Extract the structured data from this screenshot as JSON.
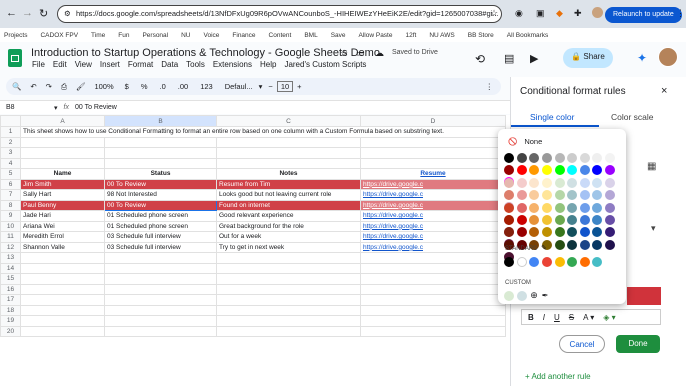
{
  "browser": {
    "url": "https://docs.google.com/spreadsheets/d/13NfDFxUg09R6pOVwANCounboS_-HIHEIWEzYHeEiK2E/edit?gid=1265007038#gi...",
    "relaunch": "Relaunch to update",
    "bookmarks": [
      "Projects",
      "CADOX FPV",
      "Time",
      "Fun",
      "Personal",
      "NU",
      "Voice",
      "Finance",
      "Content",
      "BML",
      "Save",
      "Allow Paste",
      "12ft",
      "NU AWS",
      "BB Store",
      "All Bookmarks"
    ]
  },
  "doc": {
    "title": "Introduction to Startup Operations & Technology - Google Sheets Demo",
    "saved": "Saved to Drive",
    "menus": [
      "File",
      "Edit",
      "View",
      "Insert",
      "Format",
      "Data",
      "Tools",
      "Extensions",
      "Help",
      "Jared's Custom Scripts"
    ],
    "share": "Share"
  },
  "toolbar": {
    "zoom": "100%",
    "currency": "$",
    "percent": "%",
    "dec1": ".0",
    "dec2": ".00",
    "num": "123",
    "font": "Defaul...",
    "size": "10"
  },
  "formula": {
    "cell": "B8",
    "value": "00 To Review"
  },
  "columns": [
    "A",
    "B",
    "C",
    "D"
  ],
  "rows": [
    {
      "n": "1",
      "a": "This sheet shows how to use Conditional Formatting to format an entire row based on one column with a Custom Formula based on substring text.",
      "b": "",
      "c": "",
      "d": "",
      "style": "note"
    },
    {
      "n": "2",
      "a": "",
      "b": "",
      "c": "",
      "d": ""
    },
    {
      "n": "3",
      "a": "",
      "b": "",
      "c": "",
      "d": ""
    },
    {
      "n": "4",
      "a": "",
      "b": "",
      "c": "",
      "d": ""
    },
    {
      "n": "5",
      "a": "Name",
      "b": "Status",
      "c": "Notes",
      "d": "Resume",
      "style": "header"
    },
    {
      "n": "6",
      "a": "Jim Smith",
      "b": "00 To Review",
      "c": "Resume from Tim",
      "d": "https://drive.google.c",
      "style": "red"
    },
    {
      "n": "7",
      "a": "Sally Hart",
      "b": "98 Not Interested",
      "c": "Looks good but not leaving current role",
      "d": "https://drive.google.c"
    },
    {
      "n": "8",
      "a": "Paul Benny",
      "b": "00 To Review",
      "c": "Found on internet",
      "d": "https://drive.google.c",
      "style": "red"
    },
    {
      "n": "9",
      "a": "Jade Hari",
      "b": "01 Scheduled phone screen",
      "c": "Good relevant experience",
      "d": "https://drive.google.c"
    },
    {
      "n": "10",
      "a": "Ariana Wei",
      "b": "01 Scheduled phone screen",
      "c": "Great background for the role",
      "d": "https://drive.google.c"
    },
    {
      "n": "11",
      "a": "Meredith Errol",
      "b": "03 Schedule full interview",
      "c": "Out for a week",
      "d": "https://drive.google.c"
    },
    {
      "n": "12",
      "a": "Shannon Valle",
      "b": "03 Schedule full interview",
      "c": "Try to get in next week",
      "d": "https://drive.google.c"
    },
    {
      "n": "13",
      "a": "",
      "b": "",
      "c": "",
      "d": ""
    },
    {
      "n": "14",
      "a": "",
      "b": "",
      "c": "",
      "d": ""
    },
    {
      "n": "15",
      "a": "",
      "b": "",
      "c": "",
      "d": ""
    },
    {
      "n": "16",
      "a": "",
      "b": "",
      "c": "",
      "d": ""
    },
    {
      "n": "17",
      "a": "",
      "b": "",
      "c": "",
      "d": ""
    },
    {
      "n": "18",
      "a": "",
      "b": "",
      "c": "",
      "d": ""
    },
    {
      "n": "19",
      "a": "",
      "b": "",
      "c": "",
      "d": ""
    },
    {
      "n": "20",
      "a": "",
      "b": "",
      "c": "",
      "d": ""
    }
  ],
  "panel": {
    "title": "Conditional format rules",
    "tab_single": "Single color",
    "tab_scale": "Color scale",
    "cancel": "Cancel",
    "done": "Done",
    "add_rule": "+ Add another rule"
  },
  "picker": {
    "none": "None",
    "standard": "STANDARD",
    "custom": "CUSTOM",
    "grid": [
      [
        "#000000",
        "#434343",
        "#666666",
        "#999999",
        "#b7b7b7",
        "#cccccc",
        "#d9d9d9",
        "#efefef",
        "#f3f3f3",
        "#ffffff"
      ],
      [
        "#980000",
        "#ff0000",
        "#ff9900",
        "#ffff00",
        "#00ff00",
        "#00ffff",
        "#4a86e8",
        "#0000ff",
        "#9900ff",
        "#ff00ff"
      ],
      [
        "#e6b8af",
        "#f4cccc",
        "#fce5cd",
        "#fff2cc",
        "#d9ead3",
        "#d0e0e3",
        "#c9daf8",
        "#cfe2f3",
        "#d9d2e9",
        "#ead1dc"
      ],
      [
        "#dd7e6b",
        "#ea9999",
        "#f9cb9c",
        "#ffe599",
        "#b6d7a8",
        "#a2c4c9",
        "#a4c2f4",
        "#9fc5e8",
        "#b4a7d6",
        "#d5a6bd"
      ],
      [
        "#cc4125",
        "#e06666",
        "#f6b26b",
        "#ffd966",
        "#93c47d",
        "#76a5af",
        "#6d9eeb",
        "#6fa8dc",
        "#8e7cc3",
        "#c27ba0"
      ],
      [
        "#a61c00",
        "#cc0000",
        "#e69138",
        "#f1c232",
        "#6aa84f",
        "#45818e",
        "#3c78d8",
        "#3d85c6",
        "#674ea7",
        "#a64d79"
      ],
      [
        "#85200c",
        "#990000",
        "#b45f06",
        "#bf9000",
        "#38761d",
        "#134f5c",
        "#1155cc",
        "#0b5394",
        "#351c75",
        "#741b47"
      ],
      [
        "#5b0f00",
        "#660000",
        "#783f04",
        "#7f6000",
        "#274e13",
        "#0c343d",
        "#1c4587",
        "#073763",
        "#20124d",
        "#4c1130"
      ]
    ],
    "standard_colors": [
      "#000000",
      "#ffffff",
      "#4285f4",
      "#ea4335",
      "#fbbc04",
      "#34a853",
      "#ff6d01",
      "#46bdc6"
    ],
    "custom_colors": [
      "#d9ead3",
      "#d0e0e3"
    ]
  }
}
